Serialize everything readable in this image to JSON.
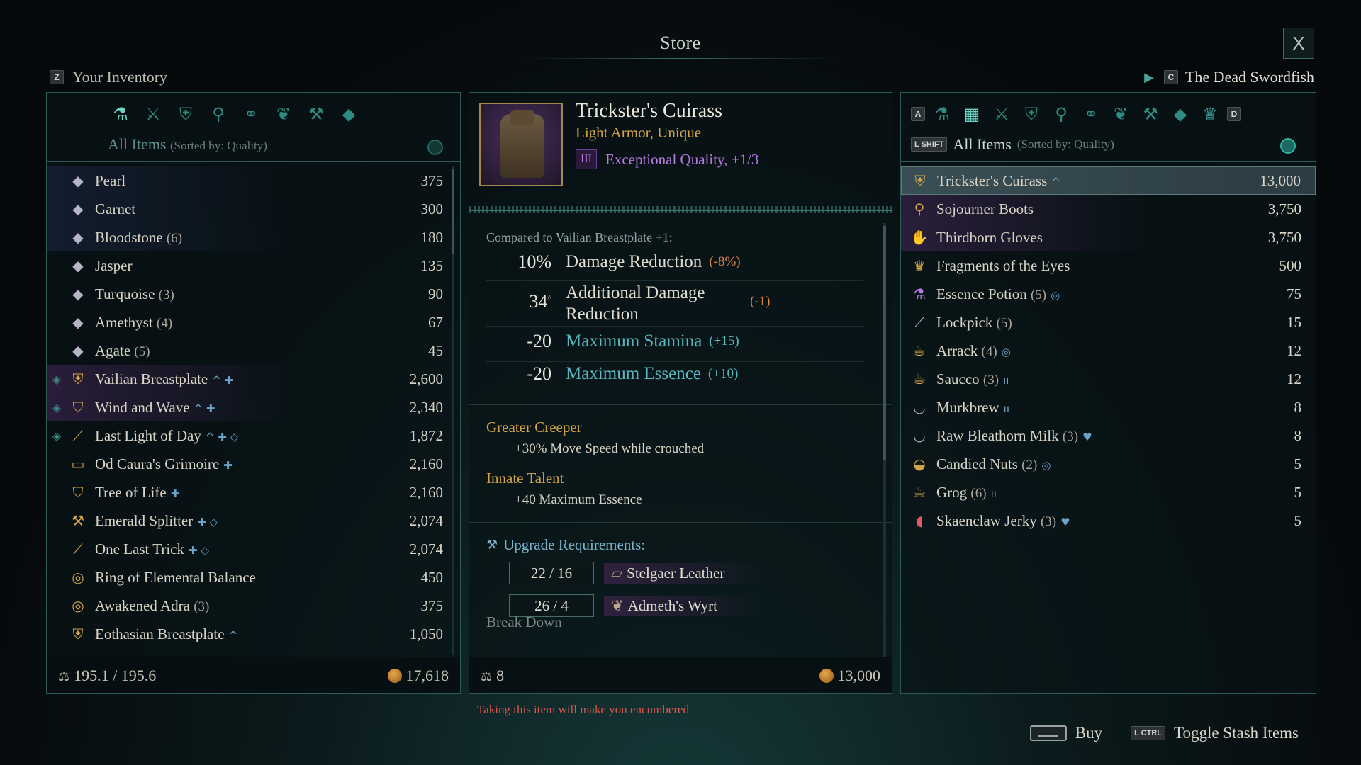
{
  "title": "Store",
  "close_label": "X",
  "left_header": {
    "key": "Z",
    "label": "Your Inventory"
  },
  "right_header": {
    "key": "C",
    "label": "The Dead Swordfish"
  },
  "left_panel": {
    "filter_label": "All Items",
    "sort_label": "(Sorted by: Quality)",
    "categories": [
      "potion-flask-icon",
      "crossed-swords-icon",
      "armor-icon",
      "boots-icon",
      "rings-icon",
      "herb-icon",
      "anvil-icon",
      "gem-icon"
    ],
    "items": [
      {
        "name": "Pearl",
        "count": "",
        "value": "375",
        "icon": "gem",
        "style": "bluish",
        "gem": false
      },
      {
        "name": "Garnet",
        "count": "",
        "value": "300",
        "icon": "gem",
        "style": "bluish",
        "gem": false
      },
      {
        "name": "Bloodstone",
        "count": "(6)",
        "value": "180",
        "icon": "gem",
        "style": "bluish",
        "gem": false
      },
      {
        "name": "Jasper",
        "count": "",
        "value": "135",
        "icon": "gem",
        "style": "",
        "gem": false
      },
      {
        "name": "Turquoise",
        "count": "(3)",
        "value": "90",
        "icon": "gem",
        "style": "",
        "gem": false
      },
      {
        "name": "Amethyst",
        "count": "(4)",
        "value": "67",
        "icon": "gem",
        "style": "",
        "gem": false
      },
      {
        "name": "Agate",
        "count": "(5)",
        "value": "45",
        "icon": "gem",
        "style": "",
        "gem": false
      },
      {
        "name": "Vailian Breastplate",
        "count": "",
        "value": "2,600",
        "icon": "armor",
        "style": "purple",
        "gem": true,
        "tag": "^ ✚"
      },
      {
        "name": "Wind and Wave",
        "count": "",
        "value": "2,340",
        "icon": "shield",
        "style": "purple",
        "gem": true,
        "tag": "^ ✚"
      },
      {
        "name": "Last Light of Day",
        "count": "",
        "value": "1,872",
        "icon": "sword",
        "style": "",
        "gem": true,
        "tag": "^ ✚ ◇"
      },
      {
        "name": "Od Caura's Grimoire",
        "count": "",
        "value": "2,160",
        "icon": "book",
        "style": "",
        "gem": false,
        "tag": "✚"
      },
      {
        "name": "Tree of Life",
        "count": "",
        "value": "2,160",
        "icon": "shield",
        "style": "",
        "gem": false,
        "tag": "✚"
      },
      {
        "name": "Emerald Splitter",
        "count": "",
        "value": "2,074",
        "icon": "axe",
        "style": "",
        "gem": false,
        "tag": "✚ ◇"
      },
      {
        "name": "One Last Trick",
        "count": "",
        "value": "2,074",
        "icon": "sword",
        "style": "",
        "gem": false,
        "tag": "✚ ◇"
      },
      {
        "name": "Ring of Elemental Balance",
        "count": "",
        "value": "450",
        "icon": "ring",
        "style": "",
        "gem": false
      },
      {
        "name": "Awakened Adra",
        "count": "(3)",
        "value": "375",
        "icon": "ring",
        "style": "",
        "gem": false
      },
      {
        "name": "Eothasian Breastplate",
        "count": "",
        "value": "1,050",
        "icon": "armor",
        "style": "",
        "gem": false,
        "tag": "^"
      }
    ],
    "weight": "195.1 / 195.6",
    "money": "17,618"
  },
  "item": {
    "name": "Trickster's Cuirass",
    "type": "Light Armor, Unique",
    "quality_numeral": "III",
    "quality": "Exceptional Quality, +1/3",
    "compared_to": "Compared to Vailian Breastplate +1:",
    "stats": [
      {
        "num": "10%",
        "sup": "",
        "label": "Damage Reduction",
        "delta": "(-8%)",
        "teal": false
      },
      {
        "num": "34",
        "sup": "^",
        "label": "Additional Damage Reduction",
        "delta": "(-1)",
        "teal": false
      },
      {
        "num": "-20",
        "sup": "",
        "label": "Maximum Stamina",
        "delta": "(+15)",
        "teal": true
      },
      {
        "num": "-20",
        "sup": "",
        "label": "Maximum Essence",
        "delta": "(+10)",
        "teal": true
      }
    ],
    "perks": [
      {
        "name": "Greater Creeper",
        "desc": "+30% Move Speed while crouched"
      },
      {
        "name": "Innate Talent",
        "desc": "+40 Maximum Essence"
      }
    ],
    "upgrade_title": "Upgrade Requirements:",
    "requirements": [
      {
        "amount": "22 / 16",
        "name": "Stelgaer Leather",
        "icon": "▱"
      },
      {
        "amount": "26 / 4",
        "name": "Admeth's Wyrt",
        "icon": "❦"
      }
    ],
    "breakdown": "Break Down",
    "weight": "8",
    "price": "13,000"
  },
  "right_panel": {
    "key_left": "A",
    "key_right": "D",
    "shift_key": "L SHIFT",
    "filter_label": "All Items",
    "sort_label": "(Sorted by: Quality)",
    "items": [
      {
        "name": "Trickster's Cuirass",
        "count": "",
        "value": "13,000",
        "icon": "armor",
        "style": "selected",
        "tag": "^"
      },
      {
        "name": "Sojourner Boots",
        "count": "",
        "value": "3,750",
        "icon": "boots",
        "style": "purple"
      },
      {
        "name": "Thirdborn Gloves",
        "count": "",
        "value": "3,750",
        "icon": "gloves",
        "style": "purple"
      },
      {
        "name": "Fragments of the Eyes",
        "count": "",
        "value": "500",
        "icon": "crown",
        "style": ""
      },
      {
        "name": "Essence Potion",
        "count": "(5)",
        "value": "75",
        "icon": "potion",
        "style": "",
        "tag": "◎"
      },
      {
        "name": "Lockpick",
        "count": "(5)",
        "value": "15",
        "icon": "pick",
        "style": ""
      },
      {
        "name": "Arrack",
        "count": "(4)",
        "value": "12",
        "icon": "mug",
        "style": "",
        "tag": "◎"
      },
      {
        "name": "Saucco",
        "count": "(3)",
        "value": "12",
        "icon": "mug",
        "style": "",
        "tag": "ıı"
      },
      {
        "name": "Murkbrew",
        "count": "",
        "value": "8",
        "icon": "cup",
        "style": "",
        "tag": "ıı"
      },
      {
        "name": "Raw Bleathorn Milk",
        "count": "(3)",
        "value": "8",
        "icon": "cup",
        "style": "",
        "tag": "♥"
      },
      {
        "name": "Candied Nuts",
        "count": "(2)",
        "value": "5",
        "icon": "bowl",
        "style": "",
        "tag": "◎"
      },
      {
        "name": "Grog",
        "count": "(6)",
        "value": "5",
        "icon": "mug",
        "style": "",
        "tag": "ıı"
      },
      {
        "name": "Skaenclaw Jerky",
        "count": "(3)",
        "value": "5",
        "icon": "meat",
        "style": "",
        "tag": "♥"
      }
    ]
  },
  "warning": "Taking this item will make you encumbered",
  "hints": [
    {
      "key": "space",
      "label": "Buy"
    },
    {
      "key": "L CTRL",
      "label": "Toggle Stash Items"
    }
  ]
}
